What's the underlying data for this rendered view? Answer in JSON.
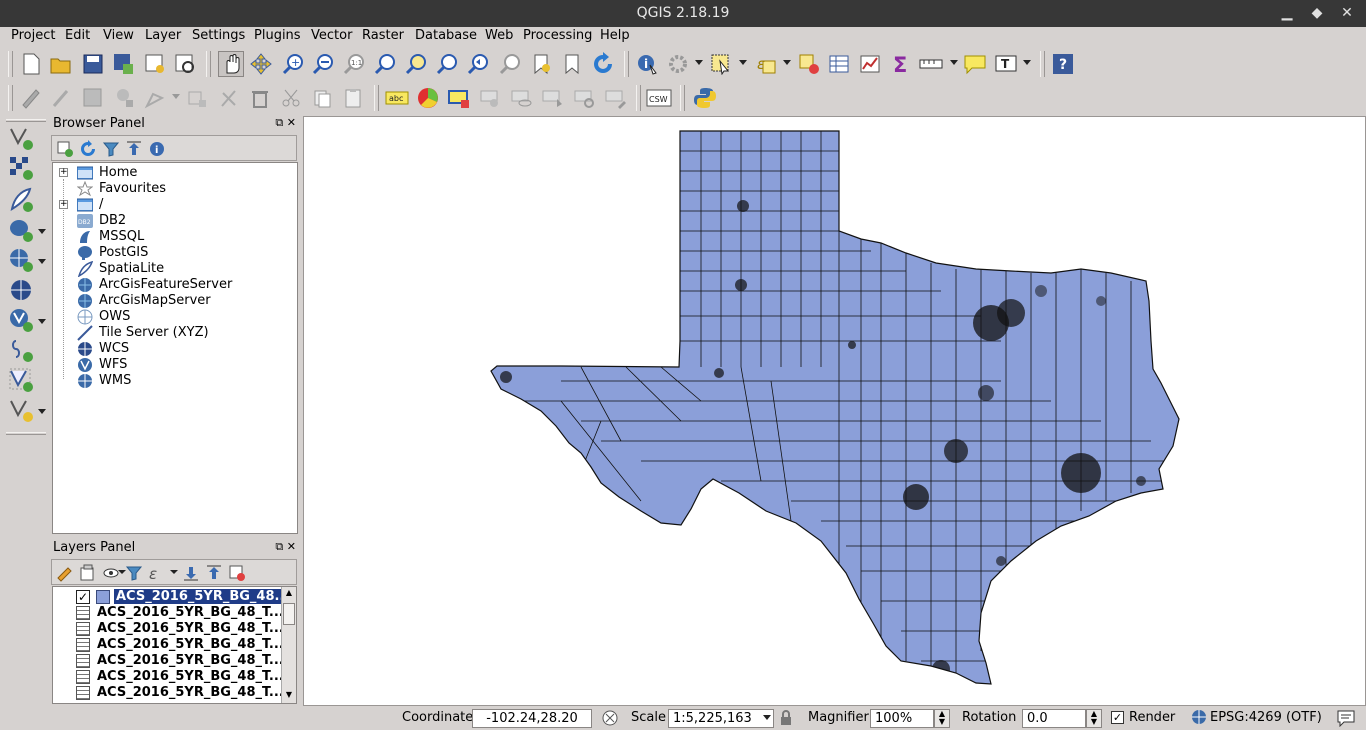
{
  "window": {
    "title": "QGIS 2.18.19"
  },
  "menu": [
    "Project",
    "Edit",
    "View",
    "Layer",
    "Settings",
    "Plugins",
    "Vector",
    "Raster",
    "Database",
    "Web",
    "Processing",
    "Help"
  ],
  "browser_panel": {
    "title": "Browser Panel",
    "items": [
      "Home",
      "Favourites",
      "/",
      "DB2",
      "MSSQL",
      "PostGIS",
      "SpatiaLite",
      "ArcGisFeatureServer",
      "ArcGisMapServer",
      "OWS",
      "Tile Server (XYZ)",
      "WCS",
      "WFS",
      "WMS"
    ]
  },
  "layers_panel": {
    "title": "Layers Panel",
    "layers": [
      "ACS_2016_5YR_BG_48...",
      "ACS_2016_5YR_BG_48_T...",
      "ACS_2016_5YR_BG_48_T...",
      "ACS_2016_5YR_BG_48_T...",
      "ACS_2016_5YR_BG_48_T...",
      "ACS_2016_5YR_BG_48_T...",
      "ACS_2016_5YR_BG_48_T..."
    ]
  },
  "toolbar": {
    "csw_label": "CSW",
    "abc_label": "abc"
  },
  "statusbar": {
    "coordinate_label": "Coordinate",
    "coordinate_value": "-102.24,28.20",
    "scale_label": "Scale",
    "scale_value": "1:5,225,163",
    "magnifier_label": "Magnifier",
    "magnifier_value": "100%",
    "rotation_label": "Rotation",
    "rotation_value": "0.0",
    "render_label": "Render",
    "crs_label": "EPSG:4269 (OTF)"
  },
  "colors": {
    "map_fill": "#8b9fd9",
    "selection": "#1f3c88"
  }
}
